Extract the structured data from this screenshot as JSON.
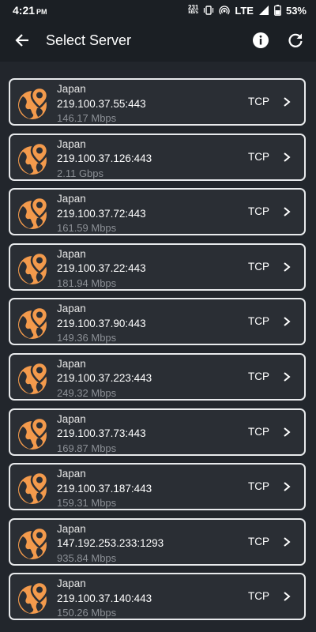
{
  "status_bar": {
    "time": "4:21",
    "ampm": "PM",
    "net_speed_value": "231",
    "net_speed_unit": "kB/s",
    "network": "LTE",
    "battery": "53%"
  },
  "app_bar": {
    "title": "Select Server",
    "back_icon": "arrow-back-icon",
    "info_icon": "info-icon",
    "refresh_icon": "refresh-icon"
  },
  "colors": {
    "accent_orange": "#f39a4c",
    "card_border": "#e8eaec",
    "card_bg": "#2a2e34",
    "speed_text": "#8c9096"
  },
  "servers": [
    {
      "country": "Japan",
      "address": "219.100.37.55:443",
      "speed": "146.17 Mbps",
      "protocol": "TCP"
    },
    {
      "country": "Japan",
      "address": "219.100.37.126:443",
      "speed": "2.11 Gbps",
      "protocol": "TCP"
    },
    {
      "country": "Japan",
      "address": "219.100.37.72:443",
      "speed": "161.59 Mbps",
      "protocol": "TCP"
    },
    {
      "country": "Japan",
      "address": "219.100.37.22:443",
      "speed": "181.94 Mbps",
      "protocol": "TCP"
    },
    {
      "country": "Japan",
      "address": "219.100.37.90:443",
      "speed": "149.36 Mbps",
      "protocol": "TCP"
    },
    {
      "country": "Japan",
      "address": "219.100.37.223:443",
      "speed": "249.32 Mbps",
      "protocol": "TCP"
    },
    {
      "country": "Japan",
      "address": "219.100.37.73:443",
      "speed": "169.87 Mbps",
      "protocol": "TCP"
    },
    {
      "country": "Japan",
      "address": "219.100.37.187:443",
      "speed": "159.31 Mbps",
      "protocol": "TCP"
    },
    {
      "country": "Japan",
      "address": "147.192.253.233:1293",
      "speed": "935.84 Mbps",
      "protocol": "TCP"
    },
    {
      "country": "Japan",
      "address": "219.100.37.140:443",
      "speed": "150.26 Mbps",
      "protocol": "TCP"
    }
  ]
}
